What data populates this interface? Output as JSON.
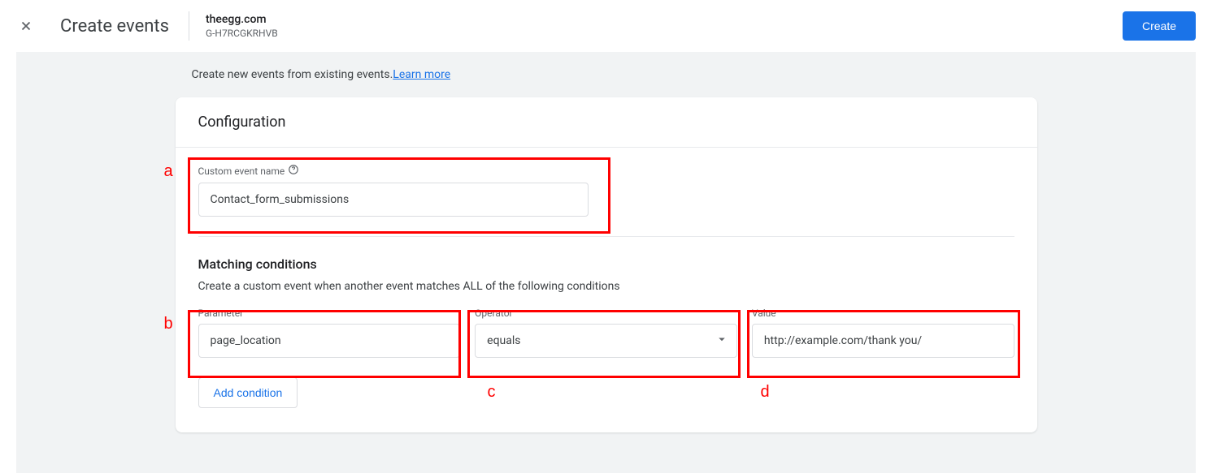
{
  "header": {
    "title": "Create events",
    "property_name": "theegg.com",
    "property_id": "G-H7RCGKRHVB",
    "create_button": "Create"
  },
  "intro": {
    "text": "Create new events from existing events.",
    "learn_more": "Learn more"
  },
  "card": {
    "title": "Configuration",
    "custom_event_label": "Custom event name",
    "custom_event_value": "Contact_form_submissions",
    "matching_title": "Matching conditions",
    "matching_subtitle": "Create a custom event when another event matches ALL of the following conditions",
    "condition": {
      "parameter_label": "Parameter",
      "parameter_value": "page_location",
      "operator_label": "Operator",
      "operator_value": "equals",
      "value_label": "Value",
      "value_value": "http://example.com/thank you/"
    },
    "add_condition": "Add condition"
  },
  "annotations": {
    "a": "a",
    "b": "b",
    "c": "c",
    "d": "d"
  }
}
